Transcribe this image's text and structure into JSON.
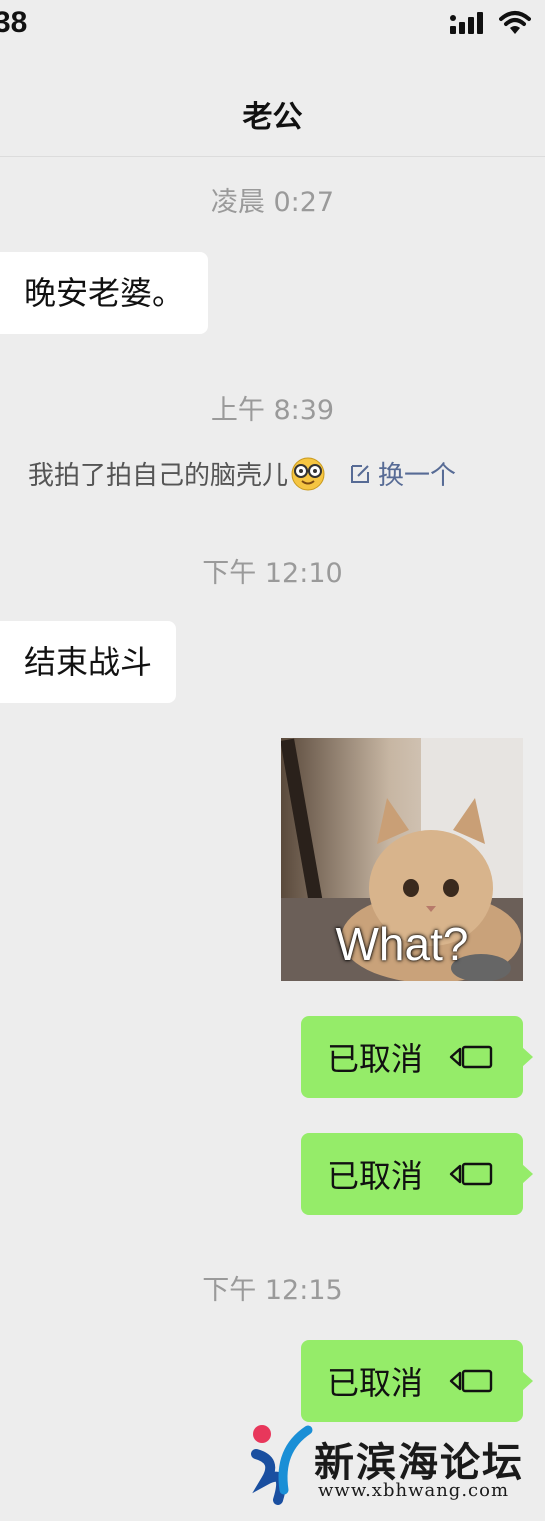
{
  "status_bar": {
    "time": "38",
    "icons": [
      "signal-icon",
      "wifi-icon"
    ]
  },
  "header": {
    "title": "老公"
  },
  "messages": [
    {
      "type": "timestamp",
      "text": "凌晨 0:27"
    },
    {
      "type": "incoming",
      "text": "晚安老婆。"
    },
    {
      "type": "timestamp",
      "text": "上午 8:39"
    },
    {
      "type": "system",
      "text": "我拍了拍自己的脑壳儿",
      "action": "换一个"
    },
    {
      "type": "timestamp",
      "text": "下午 12:10"
    },
    {
      "type": "incoming",
      "text": "结束战斗"
    },
    {
      "type": "outgoing-sticker",
      "caption": "What?"
    },
    {
      "type": "outgoing-call",
      "text": "已取消"
    },
    {
      "type": "outgoing-call",
      "text": "已取消"
    },
    {
      "type": "timestamp",
      "text": "下午 12:15"
    },
    {
      "type": "outgoing-call",
      "text": "已取消"
    }
  ],
  "watermark": {
    "name": "新滨海论坛",
    "url": "www.xbhwang.com"
  },
  "colors": {
    "background": "#ededed",
    "outgoing_bubble": "#95ec69",
    "incoming_bubble": "#ffffff",
    "link": "#576b95",
    "timestamp": "#9a9a9a"
  }
}
